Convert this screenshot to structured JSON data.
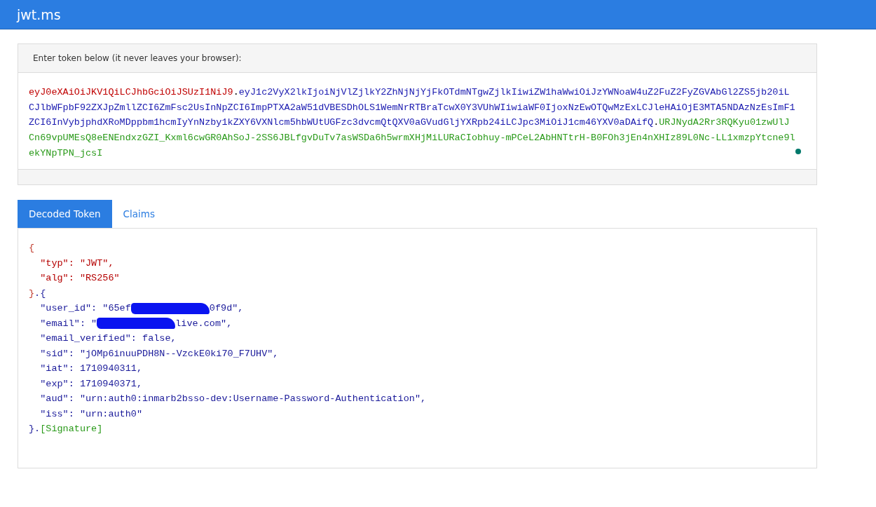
{
  "app": {
    "title": "jwt.ms"
  },
  "token_panel": {
    "heading": "Enter token below (it never leaves your browser):",
    "token": [
      {
        "kind": "header",
        "text": "eyJ0eXAiOiJKV1QiLCJhbGciOiJSUzI1NiJ9"
      },
      {
        "kind": "dot",
        "text": "."
      },
      {
        "kind": "payload",
        "text": "eyJ1c2VyX2lkIjoiNjVlZjlkY2ZhNjNjYjFkOTdmNTgwZjlkIiwiZW1haWwiOiJzYWNoaW4uZ2FuZ2FyZGVAbGl2ZS5jb20iLCJlbWFpbF92ZXJpZmllZCI6ZmFsc2UsInNpZCI6ImpPTXA2aW51dVBESDhOLS1WemNrRTBraTcwX0Y3VUhWIiwiaWF0IjoxNzEwOTQwMzExLCJleHAiOjE3MTA5NDAzNzEsImF1ZCI6InVybjphdXRoMDppbm1hcmIyYnNzby1kZXY6VXNlcm5hbWUtUGFzc3dvcmQtQXV0aGVudGljYXRpb24iLCJpc3MiOiJ1cm46YXV0aDAifQ"
      },
      {
        "kind": "dot",
        "text": "."
      },
      {
        "kind": "signature",
        "text": "URJNydA2Rr3RQKyu01zwUlJCn69vpUMEsQ8eENEndxzGZI_Kxml6cwGR0AhSoJ-2SS6JBLfgvDuTv7asWSDa6h5wrmXHjMiLURaCIobhuy-mPCeL2AbHNTtrH-B0FOh3jEn4nXHIz89L0Nc-LL1xmzpYtcne9lekYNpTPN_jcsI"
      }
    ],
    "status_dot": {
      "color": "#00796b"
    }
  },
  "tabs": [
    {
      "label": "Decoded Token",
      "selected": true
    },
    {
      "label": "Claims",
      "selected": false
    }
  ],
  "decoded_lines": [
    [
      {
        "kind": "brace",
        "text": "{"
      }
    ],
    [
      {
        "kind": "header",
        "text": "  \"typ\": \"JWT\","
      }
    ],
    [
      {
        "kind": "header",
        "text": "  \"alg\": \"RS256\""
      }
    ],
    [
      {
        "kind": "brace",
        "text": "}"
      },
      {
        "kind": "payload",
        "text": ".{"
      }
    ],
    [
      {
        "kind": "payload",
        "text": "  \"user_id\": \"65ef"
      },
      {
        "kind": "redaction"
      },
      {
        "kind": "payload",
        "text": "0f9d\","
      }
    ],
    [
      {
        "kind": "payload",
        "text": "  \"email\": \""
      },
      {
        "kind": "redaction"
      },
      {
        "kind": "payload",
        "text": "live.com\","
      }
    ],
    [
      {
        "kind": "payload",
        "text": "  \"email_verified\": false,"
      }
    ],
    [
      {
        "kind": "payload",
        "text": "  \"sid\": \"jOMp6inuuPDH8N--VzckE0ki70_F7UHV\","
      }
    ],
    [
      {
        "kind": "payload",
        "text": "  \"iat\": 1710940311,"
      }
    ],
    [
      {
        "kind": "payload",
        "text": "  \"exp\": 1710940371,"
      }
    ],
    [
      {
        "kind": "payload",
        "text": "  \"aud\": \"urn:auth0:inmarb2bsso-dev:Username-Password-Authentication\","
      }
    ],
    [
      {
        "kind": "payload",
        "text": "  \"iss\": \"urn:auth0\""
      }
    ],
    [
      {
        "kind": "payload",
        "text": "}."
      },
      {
        "kind": "signature",
        "text": "[Signature]"
      }
    ]
  ]
}
